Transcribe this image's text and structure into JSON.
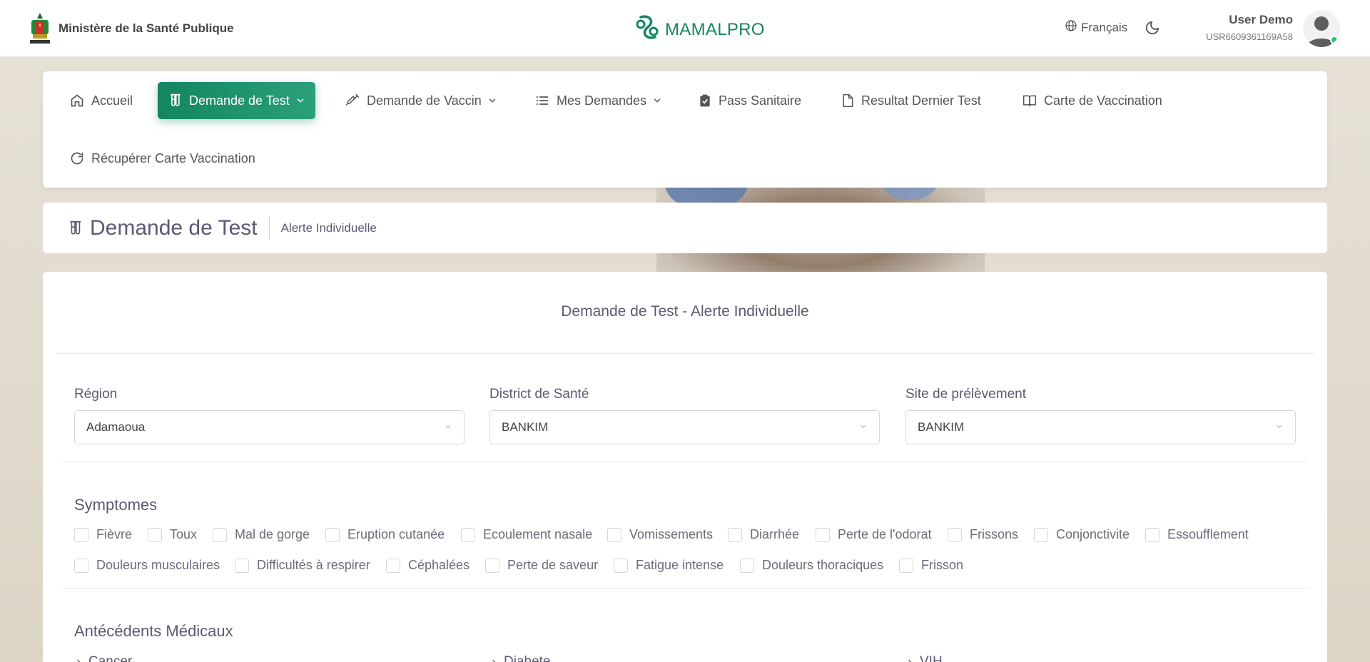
{
  "header": {
    "ministry": "Ministère de la Santé Publique",
    "app_name": "MAMALPRO",
    "language": "Français",
    "user_name": "User Demo",
    "user_id": "USR6609361169A58",
    "brand_color": "#138561"
  },
  "nav": {
    "items": [
      {
        "label": "Accueil",
        "icon": "home-icon"
      },
      {
        "label": "Demande de Test",
        "icon": "test-tube-icon",
        "active": true,
        "dropdown": true
      },
      {
        "label": "Demande de Vaccin",
        "icon": "syringe-icon",
        "dropdown": true
      },
      {
        "label": "Mes Demandes",
        "icon": "list-icon",
        "dropdown": true
      },
      {
        "label": "Pass Sanitaire",
        "icon": "clipboard-check-icon"
      },
      {
        "label": "Resultat Dernier Test",
        "icon": "file-icon"
      },
      {
        "label": "Carte de Vaccination",
        "icon": "book-icon"
      },
      {
        "label": "Récupérer Carte Vaccination",
        "icon": "refresh-icon"
      }
    ]
  },
  "breadcrumb": {
    "title": "Demande de Test",
    "sub": "Alerte Individuelle"
  },
  "form": {
    "heading": "Demande de Test - Alerte Individuelle",
    "fields": [
      {
        "label": "Région",
        "value": "Adamaoua"
      },
      {
        "label": "District de Santé",
        "value": "BANKIM"
      },
      {
        "label": "Site de prélèvement",
        "value": "BANKIM"
      }
    ],
    "symptoms_title": "Symptomes",
    "symptoms": [
      "Fièvre",
      "Toux",
      "Mal de gorge",
      "Eruption cutanée",
      "Ecoulement nasale",
      "Vomissements",
      "Diarrhée",
      "Perte de l'odorat",
      "Frissons",
      "Conjonctivite",
      "Essoufflement",
      "Douleurs musculaires",
      "Difficultés à respirer",
      "Céphalées",
      "Perte de saveur",
      "Fatigue intense",
      "Douleurs thoraciques",
      "Frisson"
    ],
    "history_title": "Antécédents Médicaux",
    "history": [
      "Cancer",
      "Diabete",
      "VIH"
    ]
  }
}
